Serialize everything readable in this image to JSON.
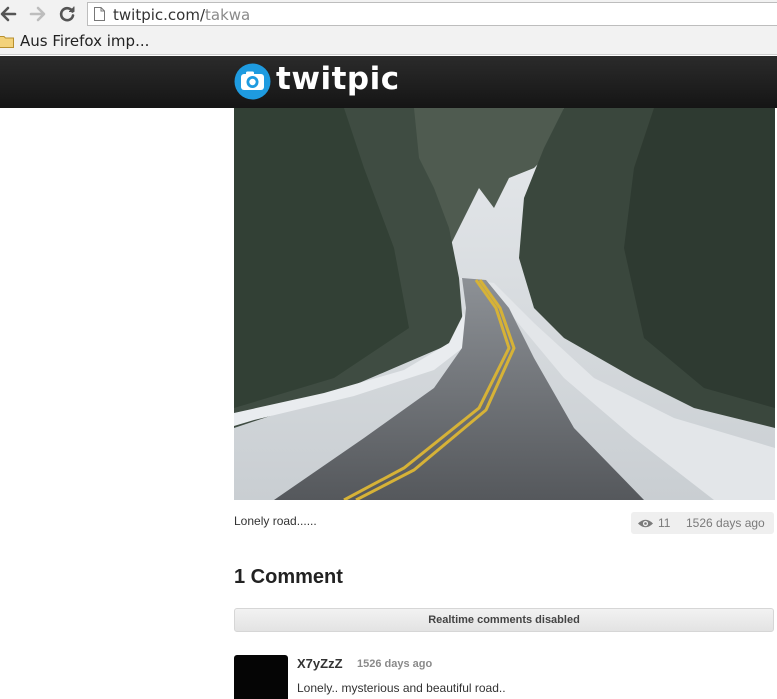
{
  "browser": {
    "url_domain": "twitpic.com/",
    "url_path": "takwa",
    "bookmark_label": "Aus Firefox imp..."
  },
  "site": {
    "logo_text": "twitpic"
  },
  "photo": {
    "caption": "Lonely road......",
    "views": "11",
    "age": "1526 days ago"
  },
  "comments": {
    "title": "1 Comment",
    "realtime_notice": "Realtime comments disabled",
    "items": [
      {
        "user": "X7yZzZ",
        "time": "1526 days ago",
        "text": "Lonely.. mysterious and beautiful road.."
      }
    ]
  },
  "colors": {
    "logo_blue": "#1e9be0",
    "header_dark": "#1c1c1c"
  }
}
